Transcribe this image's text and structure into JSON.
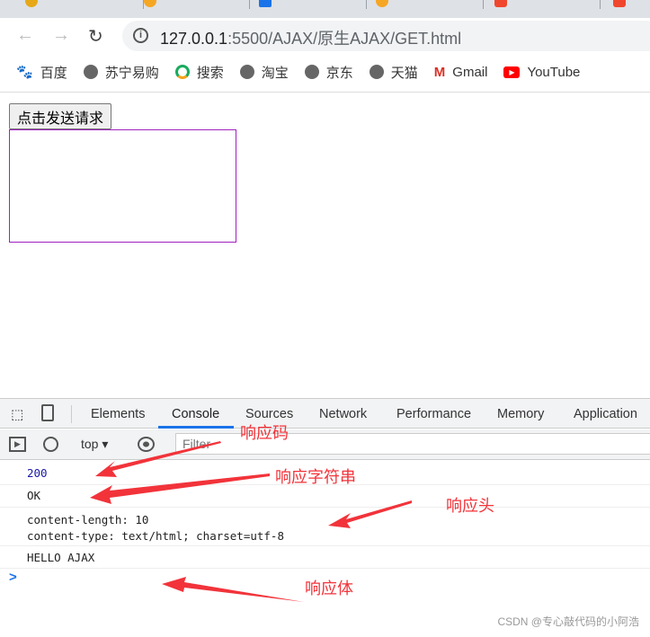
{
  "browser": {
    "url_host": "127.0.0.1",
    "url_rest": ":5500/AJAX/原生AJAX/GET.html",
    "bookmarks": [
      {
        "label": "百度",
        "icon": "baidu-icon"
      },
      {
        "label": "苏宁易购",
        "icon": "globe-icon"
      },
      {
        "label": "搜索",
        "icon": "search-ring-icon"
      },
      {
        "label": "淘宝",
        "icon": "globe-icon"
      },
      {
        "label": "京东",
        "icon": "globe-icon"
      },
      {
        "label": "天猫",
        "icon": "globe-icon"
      },
      {
        "label": "Gmail",
        "icon": "gmail-icon"
      },
      {
        "label": "YouTube",
        "icon": "youtube-icon"
      }
    ]
  },
  "page": {
    "send_button": "点击发送请求",
    "result_border_color": "#a020c0"
  },
  "devtools": {
    "tabs": [
      "Elements",
      "Console",
      "Sources",
      "Network",
      "Performance",
      "Memory",
      "Application"
    ],
    "active_tab": "Console",
    "context": "top",
    "filter_placeholder": "Filter",
    "console": {
      "status": "200",
      "status_text": "OK",
      "headers_1": "content-length: 10",
      "headers_2": "content-type: text/html; charset=utf-8",
      "body": "HELLO AJAX",
      "prompt": ">"
    }
  },
  "annotations": {
    "code": "响应码",
    "string": "响应字符串",
    "headers": "响应头",
    "body": "响应体",
    "color": "#f2333a"
  },
  "watermark": "CSDN @专心敲代码的小阿浩"
}
